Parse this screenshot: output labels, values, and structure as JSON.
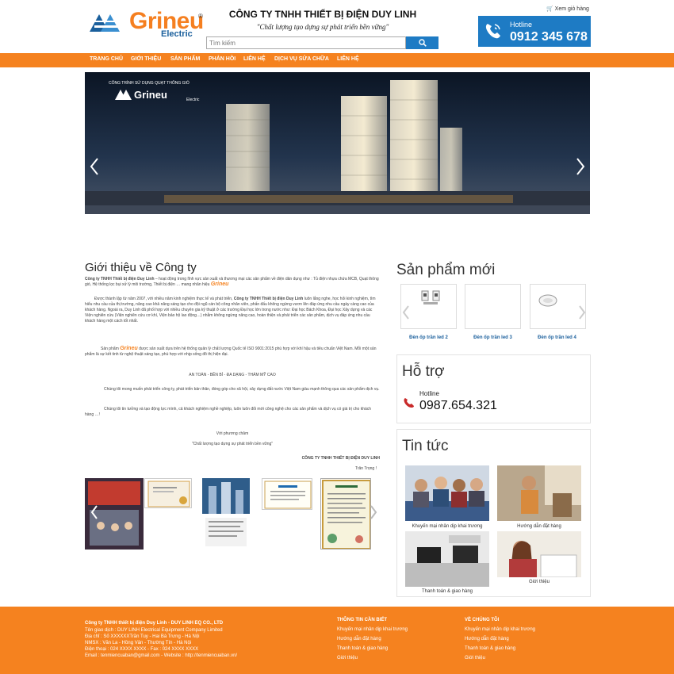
{
  "header": {
    "logo_text": "Grineu",
    "logo_sub": "Electric",
    "logo_reg": "®",
    "company_name": "CÔNG TY TNHH THIẾT BỊ ĐIỆN DUY LINH",
    "slogan": "\"Chất lượng tạo dựng sự phát triển bền vững\"",
    "search_placeholder": "Tìm kiếm",
    "cart_label": "Xem giỏ hàng",
    "hotline_label": "Hotline",
    "hotline_number": "0912 345 678"
  },
  "nav": [
    "TRANG CHỦ",
    "GIỚI THIỆU",
    "SẢN PHẨM",
    "PHẢN HỒI",
    "LIÊN HỆ",
    "DỊCH VỤ SỬA CHỮA",
    "LIÊN HỆ"
  ],
  "hero": {
    "caption": "CÔNG TRÌNH SỬ DỤNG QUẠT THÔNG GIÓ",
    "brand": "Grineu",
    "brand_sub": "Electric"
  },
  "intro": {
    "title": "Giới thiệu về Công ty",
    "p1_bold": "Công ty TNHH Thiết bị điện Duy Linh",
    "p1_rest": " – hoạt động trong lĩnh vực sản xuất và thương mại các sản phẩm về điện dân dụng như : Tủ điện nhựa chứa MCB, Quạt thông gió, Hệ thống lọc bụi xử lý môi trường, Thiết bị điện … mang nhãn hiệu ",
    "brand_inline": "Grineu",
    "p2_a": "Được thành lập từ năm 2007, với nhiều năm kinh nghiệm thực tế và phát triển, ",
    "p2_bold": "Công ty TNHH Thiết bị điện Duy Linh",
    "p2_b": " luôn lắng nghe, học hỏi kinh nghiệm, tìm hiểu nhu cầu của thị trường, nâng cao khả năng sáng tạo cho đội ngũ cán bộ công nhân viên, phấn đấu không ngừng vươn lên đáp ứng nhu cầu ngày càng cao của khách hàng. Ngoài ra, Duy Linh đã phối hợp với nhiều chuyên gia kỹ thuật ở các trường Đại học lớn trong nước như: Đại học Bách Khoa, Đại học Xây dựng và các Viện nghiên cứu (Viện nghiên cứu cơ khí, Viện bảo hộ lao động…) nhằm không ngừng nâng cao, hoàn thiện và phát triển các sản phẩm, dịch vụ đáp ứng nhu cầu khách hàng một cách tốt nhất.",
    "p3_a": "Sản phẩm ",
    "p3_brand": "Grineu",
    "p3_b": " được sản xuất dựa trên hệ thống quản lý chất lượng Quốc tế ISO 9001:2015 phù hợp với khí hậu và tiêu chuẩn Việt Nam. Mỗi một sản phẩm là sự kết tinh từ nghệ thuật sáng tạo, phù hợp với nhịp sống đô thị hiện đại.",
    "motto": "AN TOÀN - BỀN BỈ - ĐA DẠNG - THẨM MỸ CAO",
    "p4": "Chúng tôi mong muốn phát triển công ty, phát triển bản thân, đóng góp cho xã hội, xây dựng đất nước Việt Nam giàu mạnh thông qua các sản phẩm dịch vụ.",
    "p5": "Chúng tôi tin tưởng và tạo động lực mình, cả khách nghiệm nghề nghiệp, luôn luôn đổi mới công nghệ cho các sản phẩm và dịch vụ có giá trị cho khách hàng …!",
    "closing1": "Với phương châm",
    "closing2": "\"Chất lượng tạo dựng sự phát triển bền vững\"",
    "sign_company": "CÔNG TY TNHH THIẾT BỊ ĐIỆN DUY LINH",
    "sign_regards": "Trân Trọng !"
  },
  "sidebar": {
    "new_products_title": "Sản phẩm mới",
    "products": [
      "Đèn ốp trần led 2",
      "Đèn ốp trần led 3",
      "Đèn ốp trần led 4"
    ],
    "support_title": "Hỗ trợ",
    "support_hotline_label": "Hotline",
    "support_hotline_number": "0987.654.321",
    "news_title": "Tin tức",
    "news": [
      "Khuyến mại nhân dịp khai trương",
      "Hướng dẫn đặt hàng",
      "Thanh toán & giao hàng",
      "Giới thiệu"
    ]
  },
  "footer": {
    "company_lines": [
      "Công ty TNHH thiết bị điện Duy Linh - DUY LINH EQ CO., LTD",
      "Tên giao dịch : DUY LINH Electrical Equipment Company Limited",
      "Địa chỉ : Số XXXXXXTrần Tuy - Hai Bà Trưng - Hà Nội",
      "NMSX : Văn La - Hồng Vân - Thường Tín - Hà Nội",
      "Điện thoại : 024 XXXX XXXX - Fax : 024 XXXX XXXX",
      "Email : tenmiencuaban@gmail.com - Website : http://tenmiencuaban.vn/"
    ],
    "info_title": "THÔNG TIN CẦN BIẾT",
    "info_links": [
      "Khuyến mại nhân dịp khai trương",
      "Hướng dẫn đặt hàng",
      "Thanh toán & giao hàng",
      "Giới thiệu"
    ],
    "about_title": "VỀ CHÚNG TÔI",
    "about_links": [
      "Khuyến mại nhân dịp khai trương",
      "Hướng dẫn đặt hàng",
      "Thanh toán & giao hàng",
      "Giới thiệu"
    ]
  },
  "colors": {
    "accent": "#f5821f",
    "blue": "#1e7bc4"
  }
}
